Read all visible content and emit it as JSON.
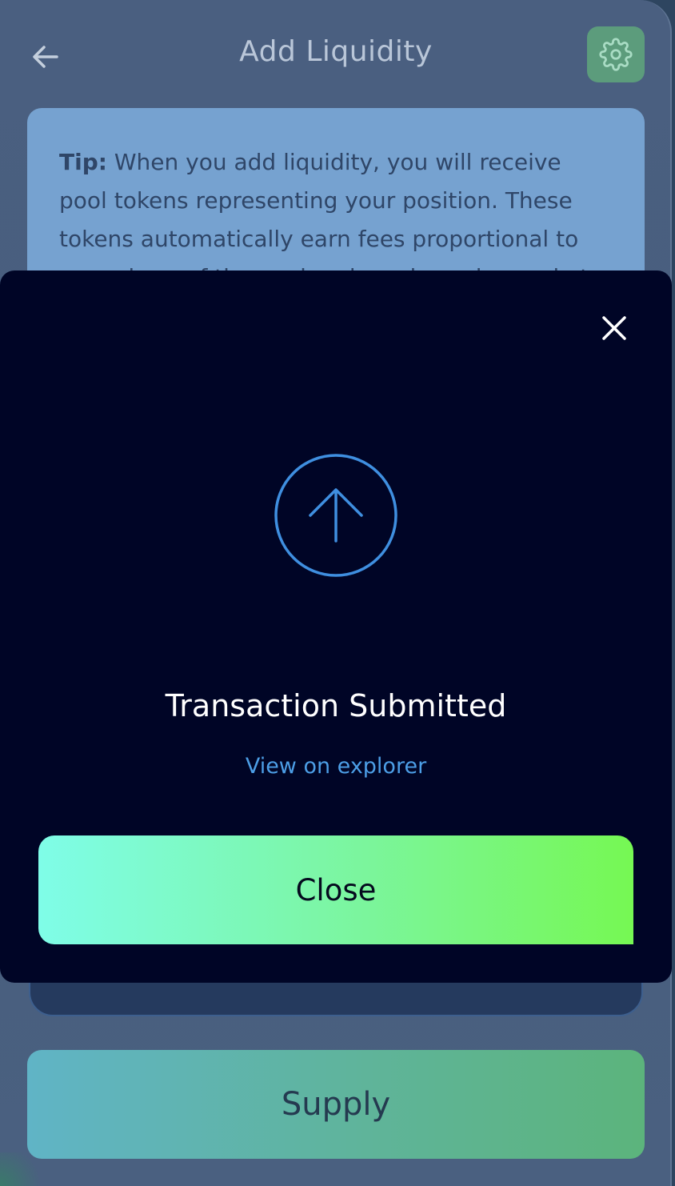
{
  "header": {
    "title": "Add Liquidity",
    "back_icon": "arrow-left-icon",
    "settings_icon": "gear-icon"
  },
  "tip": {
    "label": "Tip:",
    "text": " When you add liquidity, you will receive pool tokens representing your position. These tokens automatically earn fees proportional to your share of the pool and can be redeemed at any time."
  },
  "supply_button": {
    "label": "Supply"
  },
  "modal": {
    "close_icon": "close-icon",
    "status_icon": "arrow-up-circle-icon",
    "title": "Transaction Submitted",
    "explorer_link": "View on explorer",
    "close_label": "Close"
  },
  "colors": {
    "modal_bg": "#000526",
    "accent_blue": "#4c9ee6",
    "gradient_start": "#7ffde8",
    "gradient_end": "#76f853",
    "settings_bg": "#5c9c7c"
  }
}
